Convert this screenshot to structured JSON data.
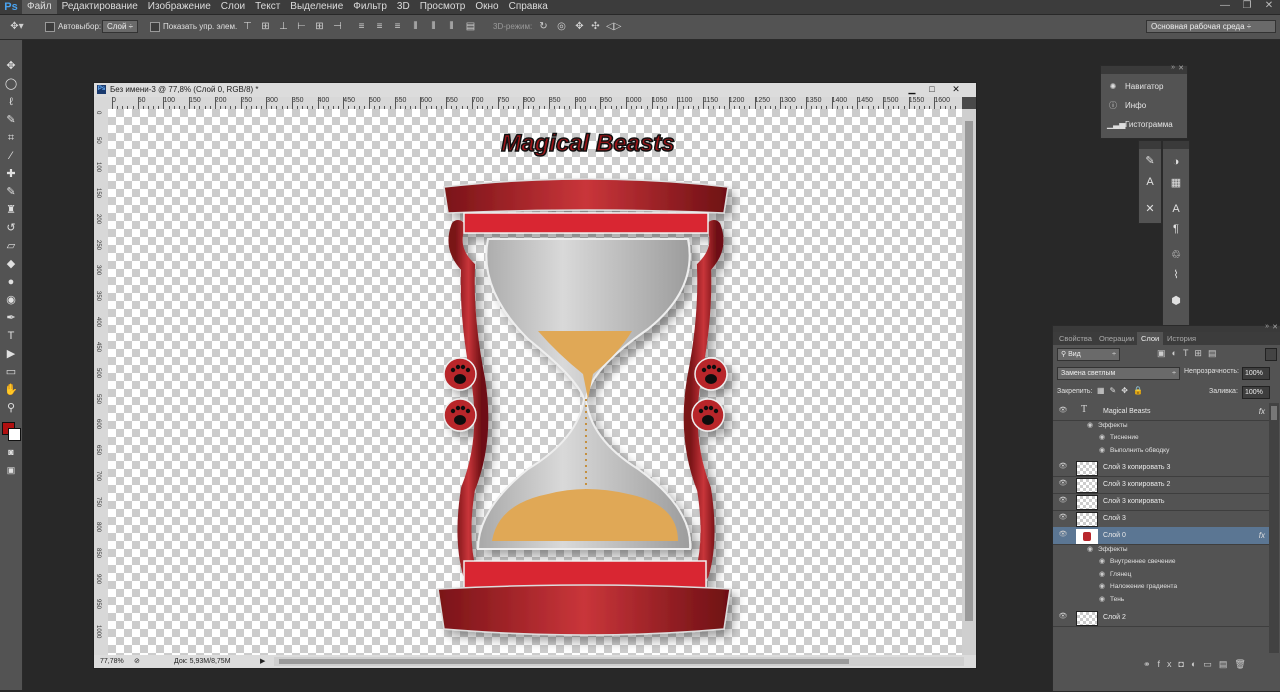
{
  "app_logo": "Ps",
  "menu": [
    "Файл",
    "Редактирование",
    "Изображение",
    "Слои",
    "Текст",
    "Выделение",
    "Фильтр",
    "3D",
    "Просмотр",
    "Окно",
    "Справка"
  ],
  "options": {
    "auto_select_label": "Автовыбор:",
    "auto_select_value": "Слой",
    "show_controls_label": "Показать упр. элем.",
    "mode_3d_label": "3D-режим:",
    "workspace": "Основная рабочая среда"
  },
  "document": {
    "title": "Без имени-3 @ 77,8% (Слой 0, RGB/8) *",
    "ruler_top": [
      "0",
      "50",
      "100",
      "150",
      "200",
      "250",
      "300",
      "350",
      "400",
      "450",
      "500",
      "550",
      "600",
      "650",
      "700",
      "750",
      "800",
      "850",
      "900",
      "950",
      "1000",
      "1050",
      "1100",
      "1150",
      "1200",
      "1250",
      "1300",
      "1350",
      "1400",
      "1450",
      "1500",
      "1550",
      "1600"
    ],
    "ruler_left": [
      "0",
      "50",
      "100",
      "150",
      "200",
      "250",
      "300",
      "350",
      "400",
      "450",
      "500",
      "550",
      "600",
      "650",
      "700",
      "750",
      "800",
      "850",
      "900",
      "950",
      "1000"
    ],
    "zoom": "77,78%",
    "doc_size": "Док: 5,93M/8,75M",
    "artwork_title": "Magical Beasts"
  },
  "mini_panel": {
    "items": [
      {
        "icon": "navigator-icon",
        "label": "Навигатор"
      },
      {
        "icon": "info-icon",
        "label": "Инфо"
      },
      {
        "icon": "histogram-icon",
        "label": "Гистограмма"
      }
    ]
  },
  "layers_panel": {
    "tabs": [
      "Свойства",
      "Операции",
      "Слои",
      "История"
    ],
    "active_tab": "Слои",
    "filter_label": "Вид",
    "blend_mode": "Замена светлым",
    "opacity_label": "Непрозрачность:",
    "opacity_value": "100%",
    "lock_label": "Закрепить:",
    "fill_label": "Заливка:",
    "fill_value": "100%",
    "layers": [
      {
        "name": "Magical Beasts",
        "type": "text",
        "fx": "fx",
        "effects_label": "Эффекты",
        "effects": [
          "Тиснение",
          "Выполнить обводку"
        ]
      },
      {
        "name": "Слой 3 копировать 3",
        "type": "pixel"
      },
      {
        "name": "Слой 3 копировать 2",
        "type": "pixel"
      },
      {
        "name": "Слой 3 копировать",
        "type": "pixel"
      },
      {
        "name": "Слой 3",
        "type": "pixel"
      },
      {
        "name": "Слой 0",
        "type": "pixel",
        "selected": true,
        "fx": "fx",
        "effects_label": "Эффекты",
        "effects": [
          "Внутреннее свечение",
          "Глянец",
          "Наложение градиента",
          "Тень"
        ]
      },
      {
        "name": "Слой 2",
        "type": "pixel"
      }
    ]
  },
  "colors": {
    "foreground": "#b01010",
    "background": "#ffffff",
    "selected_layer": "#5b7693",
    "hourglass_frame": "#b8262c",
    "sand": "#e0a856"
  }
}
